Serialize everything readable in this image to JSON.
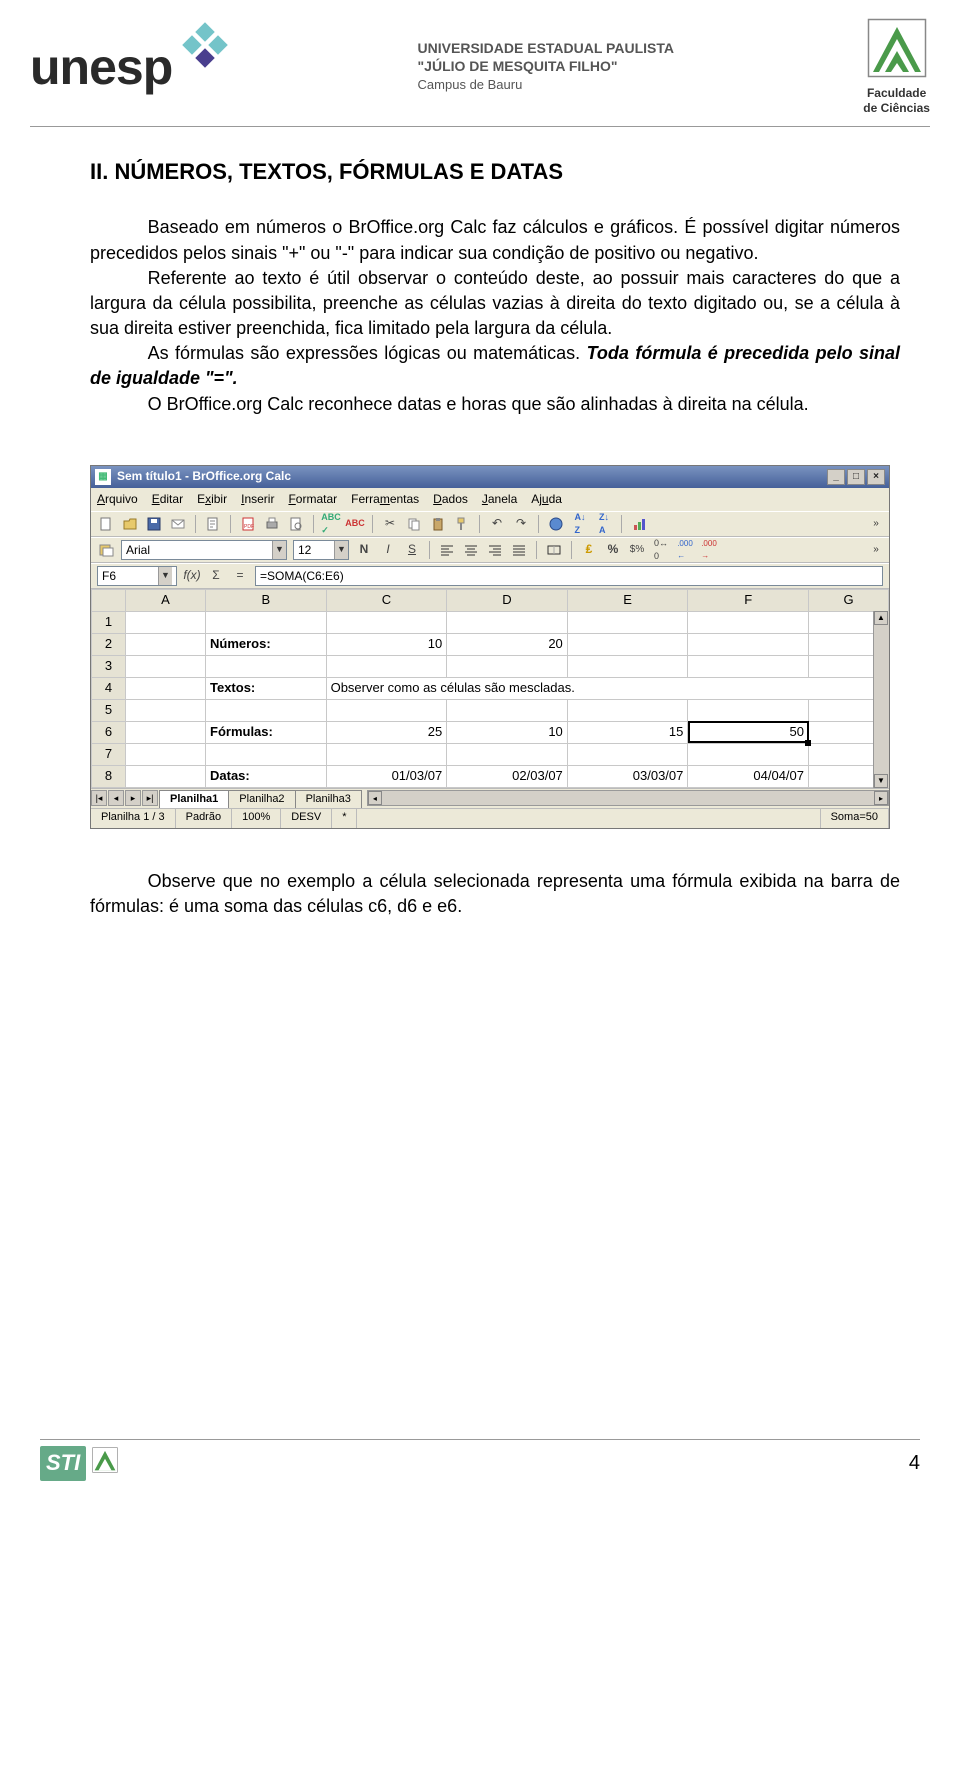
{
  "header": {
    "logo_left_text": "unesp",
    "uni_line1": "UNIVERSIDADE ESTADUAL PAULISTA",
    "uni_line2": "\"JÚLIO DE MESQUITA FILHO\"",
    "uni_line3": "Campus de Bauru",
    "fac_line1": "Faculdade",
    "fac_line2": "de Ciências"
  },
  "body": {
    "section_title": "II.    NÚMEROS, TEXTOS, FÓRMULAS E DATAS",
    "p1": "Baseado em números o BrOffice.org Calc faz cálculos e gráficos. É possível digitar números precedidos pelos sinais \"+\" ou \"-\" para indicar sua condição de positivo ou negativo.",
    "p2": "Referente ao texto é útil observar o conteúdo deste, ao possuir mais caracteres do que  a largura  da célula possibilita, preenche as células vazias à direita do texto digitado ou,  se a célula  à sua direita estiver preenchida, fica limitado pela largura da célula.",
    "p3a": "As fórmulas são expressões lógicas ou matemáticas. ",
    "p3b": "Toda fórmula é precedida pelo sinal de igualdade \"=\".",
    "p4": "O BrOffice.org Calc reconhece datas e horas que são alinhadas à direita na célula.",
    "p5": "Observe que no exemplo a célula selecionada representa uma fórmula exibida na barra de fórmulas: é uma soma das células c6, d6 e e6."
  },
  "screenshot": {
    "title": "Sem título1 - BrOffice.org Calc",
    "menus": [
      "Arquivo",
      "Editar",
      "Exibir",
      "Inserir",
      "Formatar",
      "Ferramentas",
      "Dados",
      "Janela",
      "Ajuda"
    ],
    "menu_underlines": [
      "A",
      "E",
      "x",
      "I",
      "F",
      "m",
      "D",
      "J",
      "u"
    ],
    "font_name": "Arial",
    "font_size": "12",
    "cell_ref": "F6",
    "fx_label": "f(x)",
    "sigma": "Σ",
    "eq": "=",
    "formula": "=SOMA(C6:E6)",
    "cols": [
      "A",
      "B",
      "C",
      "D",
      "E",
      "F",
      "G"
    ],
    "rows": {
      "r2": {
        "B": "Números:",
        "C": "10",
        "D": "20"
      },
      "r4": {
        "B": "Textos:",
        "merged": "Observer como as células são mescladas."
      },
      "r6": {
        "B": "Fórmulas:",
        "C": "25",
        "D": "10",
        "E": "15",
        "F": "50"
      },
      "r8": {
        "B": "Datas:",
        "C": "01/03/07",
        "D": "02/03/07",
        "E": "03/03/07",
        "F": "04/04/07"
      }
    },
    "sheet_tabs": [
      "Planilha1",
      "Planilha2",
      "Planilha3"
    ],
    "status": {
      "sheet": "Planilha 1 / 3",
      "style": "Padrão",
      "zoom": "100%",
      "mode": "DESV",
      "mark": "*",
      "sum": "Soma=50"
    }
  },
  "footer": {
    "sti": "STI",
    "page": "4"
  }
}
